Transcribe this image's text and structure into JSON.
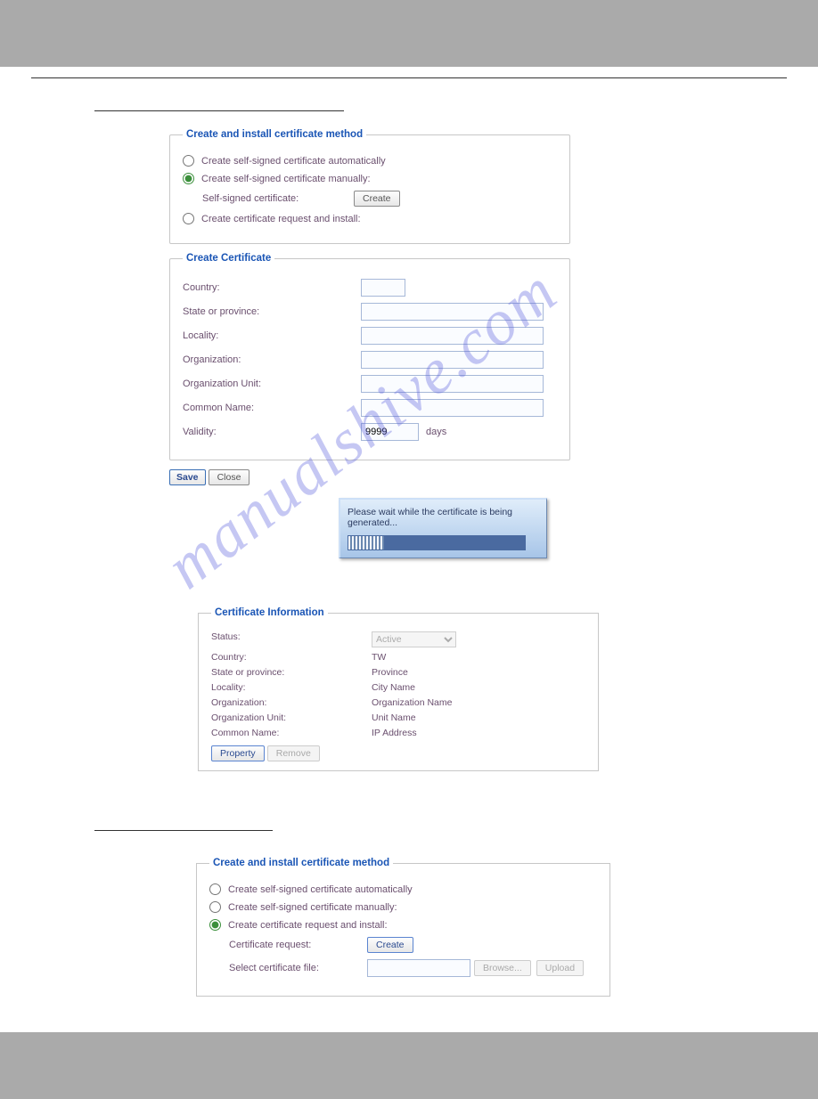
{
  "watermark": "manualshive.com",
  "panel1": {
    "legend": "Create and install certificate method",
    "opt_auto": "Create self-signed certificate automatically",
    "opt_manual": "Create self-signed certificate manually:",
    "sub_cert": "Self-signed certificate:",
    "create_btn": "Create",
    "opt_request": "Create certificate request and install:"
  },
  "panel2": {
    "legend": "Create Certificate",
    "fields": {
      "country": "Country:",
      "state": "State or province:",
      "locality": "Locality:",
      "org": "Organization:",
      "orgunit": "Organization Unit:",
      "common": "Common Name:",
      "validity": "Validity:"
    },
    "validity_value": "9999",
    "days": "days"
  },
  "actions": {
    "save": "Save",
    "close": "Close"
  },
  "progress": {
    "msg": "Please wait while the certificate is being generated..."
  },
  "info": {
    "legend": "Certificate Information",
    "status_label": "Status:",
    "status_value": "Active",
    "rows": {
      "country_l": "Country:",
      "country_v": "TW",
      "state_l": "State or province:",
      "state_v": "Province",
      "locality_l": "Locality:",
      "locality_v": "City Name",
      "org_l": "Organization:",
      "org_v": "Organization Name",
      "orgunit_l": "Organization Unit:",
      "orgunit_v": "Unit Name",
      "common_l": "Common Name:",
      "common_v": "IP Address"
    },
    "property": "Property",
    "remove": "Remove"
  },
  "panel3": {
    "legend": "Create and install certificate method",
    "opt_auto": "Create self-signed certificate automatically",
    "opt_manual": "Create self-signed certificate manually:",
    "opt_request": "Create certificate request and install:",
    "cert_req": "Certificate request:",
    "select_file": "Select certificate file:",
    "create": "Create",
    "browse": "Browse...",
    "upload": "Upload"
  }
}
